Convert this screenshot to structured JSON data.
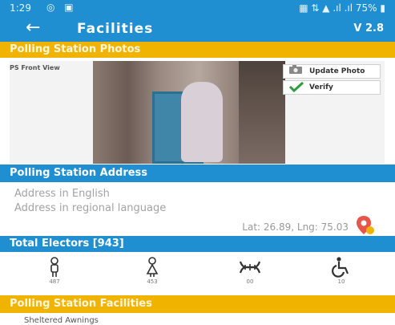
{
  "status_bar": {
    "time": "1:29",
    "left_glyphs": "◎ ▣",
    "right": "▦ ⇅ ▲ .ıl .ıl 75% ▮"
  },
  "app_bar": {
    "back_glyph": "←",
    "title": "Facilities",
    "version": "V 2.8"
  },
  "photos": {
    "header": "Polling Station Photos",
    "caption": "PS Front View",
    "upload_label": "Update Photo",
    "verify_label": "Verify"
  },
  "address": {
    "header": "Polling Station Address",
    "english_placeholder": "Address in English",
    "regional_placeholder": "Address in regional language",
    "coords": "Lat: 26.89, Lng: 75.03"
  },
  "electors": {
    "header": "Total Electors [943]",
    "items": [
      {
        "icon": "male-icon",
        "count": "487"
      },
      {
        "icon": "female-icon",
        "count": "453"
      },
      {
        "icon": "third-gender-icon",
        "count": "00"
      },
      {
        "icon": "wheelchair-icon",
        "count": "10"
      }
    ]
  },
  "facilities": {
    "header": "Polling Station Facilities",
    "first_item": "Sheltered Awnings"
  },
  "colors": {
    "primary": "#1f8fd2",
    "accent": "#f0b400",
    "pin": "#e8564a"
  }
}
